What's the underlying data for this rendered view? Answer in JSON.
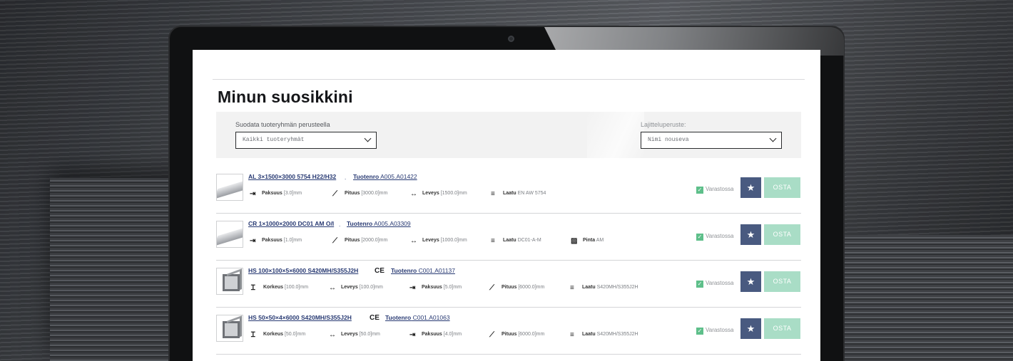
{
  "page": {
    "title": "Minun suosikkini"
  },
  "filters": {
    "group_label": "Suodata tuoteryhmän perusteella",
    "group_value": "Kaikki tuoteryhmät",
    "sort_label": "Lajitteluperuste:",
    "sort_value": "Nimi nouseva"
  },
  "products": [
    {
      "name": "AL 3×1500×3000 5754 H22/H32",
      "code_label": "Tuotenro",
      "code": "A005.A01422",
      "attrs": [
        {
          "label": "Paksuus",
          "value": "[3.0]mm"
        },
        {
          "label": "Pituus",
          "value": "[3000.0]mm"
        },
        {
          "label": "Leveys",
          "value": "[1500.0]mm"
        },
        {
          "label": "Laatu",
          "value": "EN AW 5754"
        }
      ],
      "stock": "Varastossa",
      "buy": "OSTA"
    },
    {
      "name": "CR 1×1000×2000 DC01 AM O/I",
      "code_label": "Tuotenro",
      "code": "A005.A03309",
      "attrs": [
        {
          "label": "Paksuus",
          "value": "[1.0]mm"
        },
        {
          "label": "Pituus",
          "value": "[2000.0]mm"
        },
        {
          "label": "Leveys",
          "value": "[1000.0]mm"
        },
        {
          "label": "Laatu",
          "value": "DC01-A-M"
        },
        {
          "label": "Pinta",
          "value": "AM"
        }
      ],
      "stock": "Varastossa",
      "buy": "OSTA"
    },
    {
      "name": "HS 100×100×5×6000 S420MH/S355J2H",
      "ce": "CE",
      "code_label": "Tuotenro",
      "code": "C001.A01137",
      "attrs": [
        {
          "label": "Korkeus",
          "value": "[100.0]mm"
        },
        {
          "label": "Leveys",
          "value": "[100.0]mm"
        },
        {
          "label": "Paksuus",
          "value": "[5.0]mm"
        },
        {
          "label": "Pituus",
          "value": "[6000.0]mm"
        },
        {
          "label": "Laatu",
          "value": "S420MH/S355J2H"
        }
      ],
      "stock": "Varastossa",
      "buy": "OSTA"
    },
    {
      "name": "HS 50×50×4×6000 S420MH/S355J2H",
      "ce": "CE",
      "code_label": "Tuotenro",
      "code": "C001.A01063",
      "attrs": [
        {
          "label": "Korkeus",
          "value": "[50.0]mm"
        },
        {
          "label": "Leveys",
          "value": "[50.0]mm"
        },
        {
          "label": "Paksuus",
          "value": "[4.0]mm"
        },
        {
          "label": "Pituus",
          "value": "[6000.0]mm"
        },
        {
          "label": "Laatu",
          "value": "S420MH/S355J2H"
        }
      ],
      "stock": "Varastossa",
      "buy": "OSTA"
    }
  ]
}
